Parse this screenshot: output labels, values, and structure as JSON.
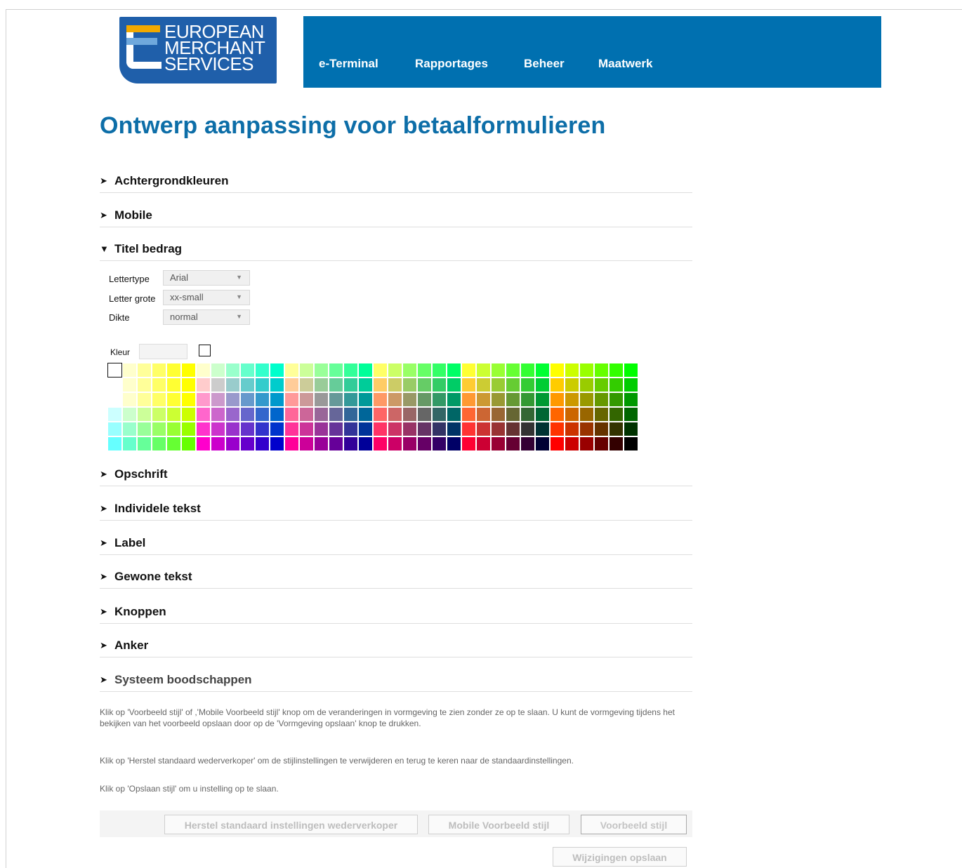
{
  "logo": {
    "line1": "EUROPEAN",
    "line2": "MERCHANT",
    "line3": "SERVICES"
  },
  "nav": {
    "items": [
      "e-Terminal",
      "Rapportages",
      "Beheer",
      "Maatwerk"
    ]
  },
  "page": {
    "title": "Ontwerp aanpassing voor betaalformulieren"
  },
  "sections": {
    "achtergrondkleuren": {
      "label": "Achtergrondkleuren",
      "arrow": "➤"
    },
    "mobile": {
      "label": "Mobile",
      "arrow": "➤"
    },
    "titel_bedrag": {
      "label": "Titel bedrag",
      "arrow": "▼"
    },
    "opschrift": {
      "label": "Opschrift",
      "arrow": "➤"
    },
    "individele_tekst": {
      "label": "Individele tekst",
      "arrow": "➤"
    },
    "label": {
      "label": "Label",
      "arrow": "➤"
    },
    "gewone_tekst": {
      "label": "Gewone tekst",
      "arrow": "➤"
    },
    "knoppen": {
      "label": "Knoppen",
      "arrow": "➤"
    },
    "anker": {
      "label": "Anker",
      "arrow": "➤"
    },
    "systeem": {
      "label": "Systeem boodschappen",
      "arrow": "➤"
    }
  },
  "titel_form": {
    "lettertype": {
      "label": "Lettertype",
      "value": "Arial"
    },
    "letter_grote": {
      "label": "Letter grote",
      "value": "xx-small"
    },
    "dikte": {
      "label": "Dikte",
      "value": "normal"
    },
    "kleur": {
      "label": "Kleur",
      "value": ""
    },
    "caret": "▼"
  },
  "help": {
    "p1": "Klik op 'Voorbeeld stijl' of ,'Mobile Voorbeeld stijl' knop om de veranderingen in vormgeving te zien zonder ze op te slaan. U kunt de vormgeving tijdens het bekijken van het voorbeeld opslaan door op de 'Vormgeving opslaan' knop te drukken.",
    "p2": "Klik op 'Herstel standaard wederverkoper' om de stijlinstellingen te verwijderen en terug te keren naar de standaardinstellingen.",
    "p3": "Klik op 'Opslaan stijl' om u instelling op te slaan."
  },
  "buttons": {
    "reset": "Herstel standaard instellingen wederverkoper",
    "mobile_preview": "Mobile Voorbeeld stijl",
    "preview": "Voorbeeld stijl",
    "save": "Wijzigingen opslaan"
  },
  "colors": {
    "nav_bg": "#0070b0",
    "title": "#0d6ea8",
    "logo_bg": "#1f5faa",
    "logo_accent": "#f2a900"
  }
}
